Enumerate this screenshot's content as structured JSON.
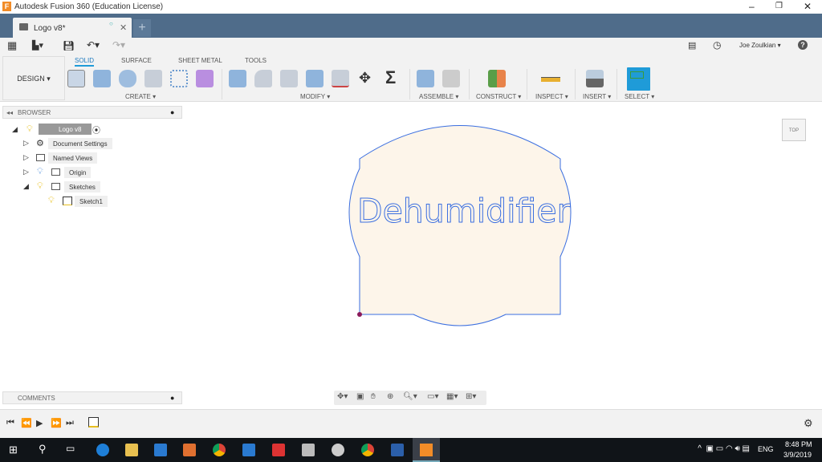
{
  "window": {
    "title": "Autodesk Fusion 360 (Education License)",
    "app_letter": "F"
  },
  "doc_tab": {
    "label": "Logo v8*"
  },
  "user": {
    "name": "Joe Zoulkian ▾"
  },
  "workspace": {
    "label": "DESIGN ▾"
  },
  "ribbon_tabs": [
    "SOLID",
    "SURFACE",
    "SHEET METAL",
    "TOOLS"
  ],
  "groups": {
    "create": "CREATE ▾",
    "modify": "MODIFY ▾",
    "assemble": "ASSEMBLE ▾",
    "construct": "CONSTRUCT ▾",
    "inspect": "INSPECT ▾",
    "insert": "INSERT ▾",
    "select": "SELECT ▾"
  },
  "browser": {
    "title": "BROWSER",
    "items": [
      {
        "label": "Logo v8"
      },
      {
        "label": "Document Settings"
      },
      {
        "label": "Named Views"
      },
      {
        "label": "Origin"
      },
      {
        "label": "Sketches"
      },
      {
        "label": "Sketch1"
      }
    ]
  },
  "comments": {
    "title": "COMMENTS"
  },
  "canvas": {
    "sketch_text": "Dehumidifier",
    "fill": "#fdf5ea",
    "stroke": "#3a6ee0"
  },
  "viewcube": {
    "face": "TOP"
  },
  "taskbar": {
    "lang": "ENG",
    "time": "8:48 PM",
    "date": "3/9/2019"
  }
}
